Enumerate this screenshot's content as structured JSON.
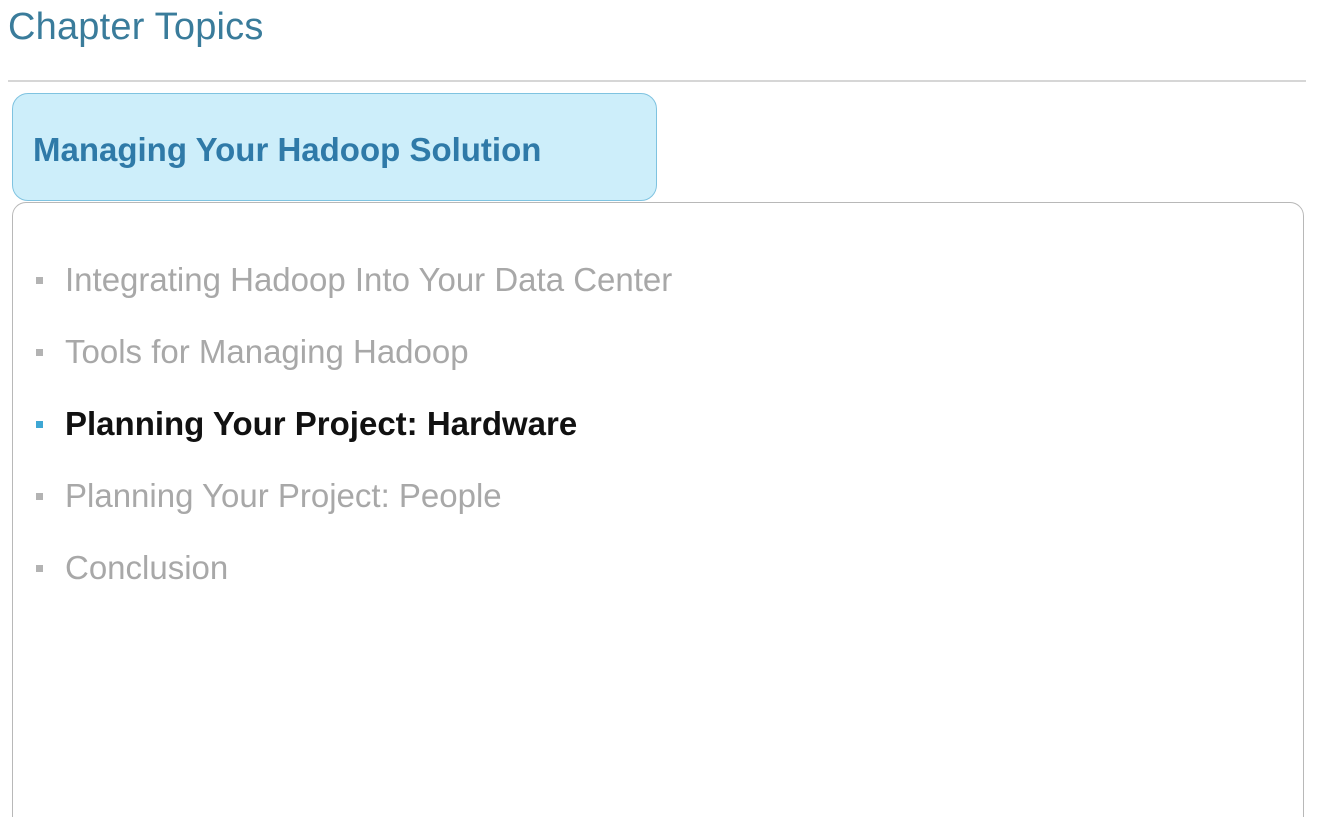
{
  "header": {
    "title": "Chapter Topics"
  },
  "section": {
    "label": "Managing Your Hadoop Solution"
  },
  "topics": [
    {
      "label": "Integrating Hadoop Into Your Data Center",
      "active": false
    },
    {
      "label": "Tools for Managing Hadoop",
      "active": false
    },
    {
      "label": "Planning Your Project: Hardware",
      "active": true
    },
    {
      "label": "Planning Your Project: People",
      "active": false
    },
    {
      "label": "Conclusion",
      "active": false
    }
  ],
  "colors": {
    "title": "#3a7c9b",
    "tab_fill": "#cdeefa",
    "tab_border": "#7fc3e0",
    "tab_text": "#2f7aa8",
    "active_bullet": "#3ea7d4",
    "inactive_text": "#a8a8a8",
    "active_text": "#111111"
  }
}
